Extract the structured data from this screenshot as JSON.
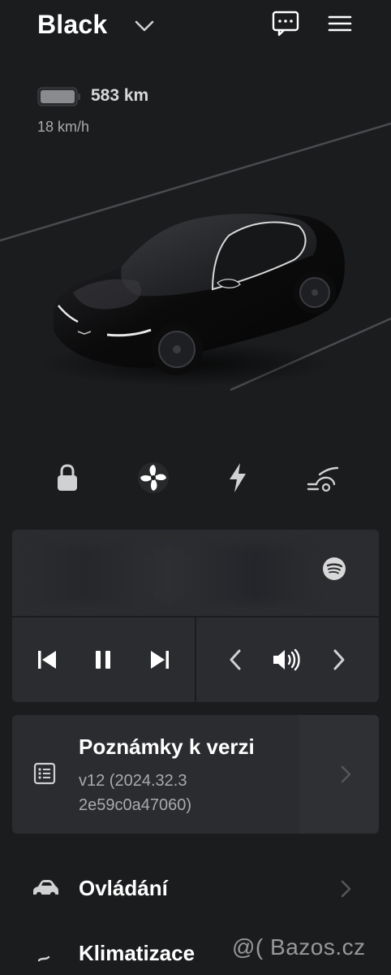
{
  "header": {
    "vehicle_name": "Black"
  },
  "status": {
    "range": "583 km",
    "speed": "18 km/h"
  },
  "quick_actions": [
    {
      "icon": "lock-icon"
    },
    {
      "icon": "fan-icon",
      "active": true
    },
    {
      "icon": "charge-icon"
    },
    {
      "icon": "trunk-icon"
    }
  ],
  "media": {
    "source_icon": "spotify-icon"
  },
  "release_notes": {
    "title": "Poznámky k verzi",
    "version_line1": "v12 (2024.32.3",
    "version_line2": "2e59c0a47060)"
  },
  "menu": {
    "controls_label": "Ovládání",
    "climate_label": "Klimatizace"
  },
  "watermark": "@( Bazos.cz",
  "colors": {
    "background": "#1b1c1e",
    "card": "#2b2c2f",
    "text_primary": "#ffffff",
    "text_secondary": "#a9aaad"
  }
}
